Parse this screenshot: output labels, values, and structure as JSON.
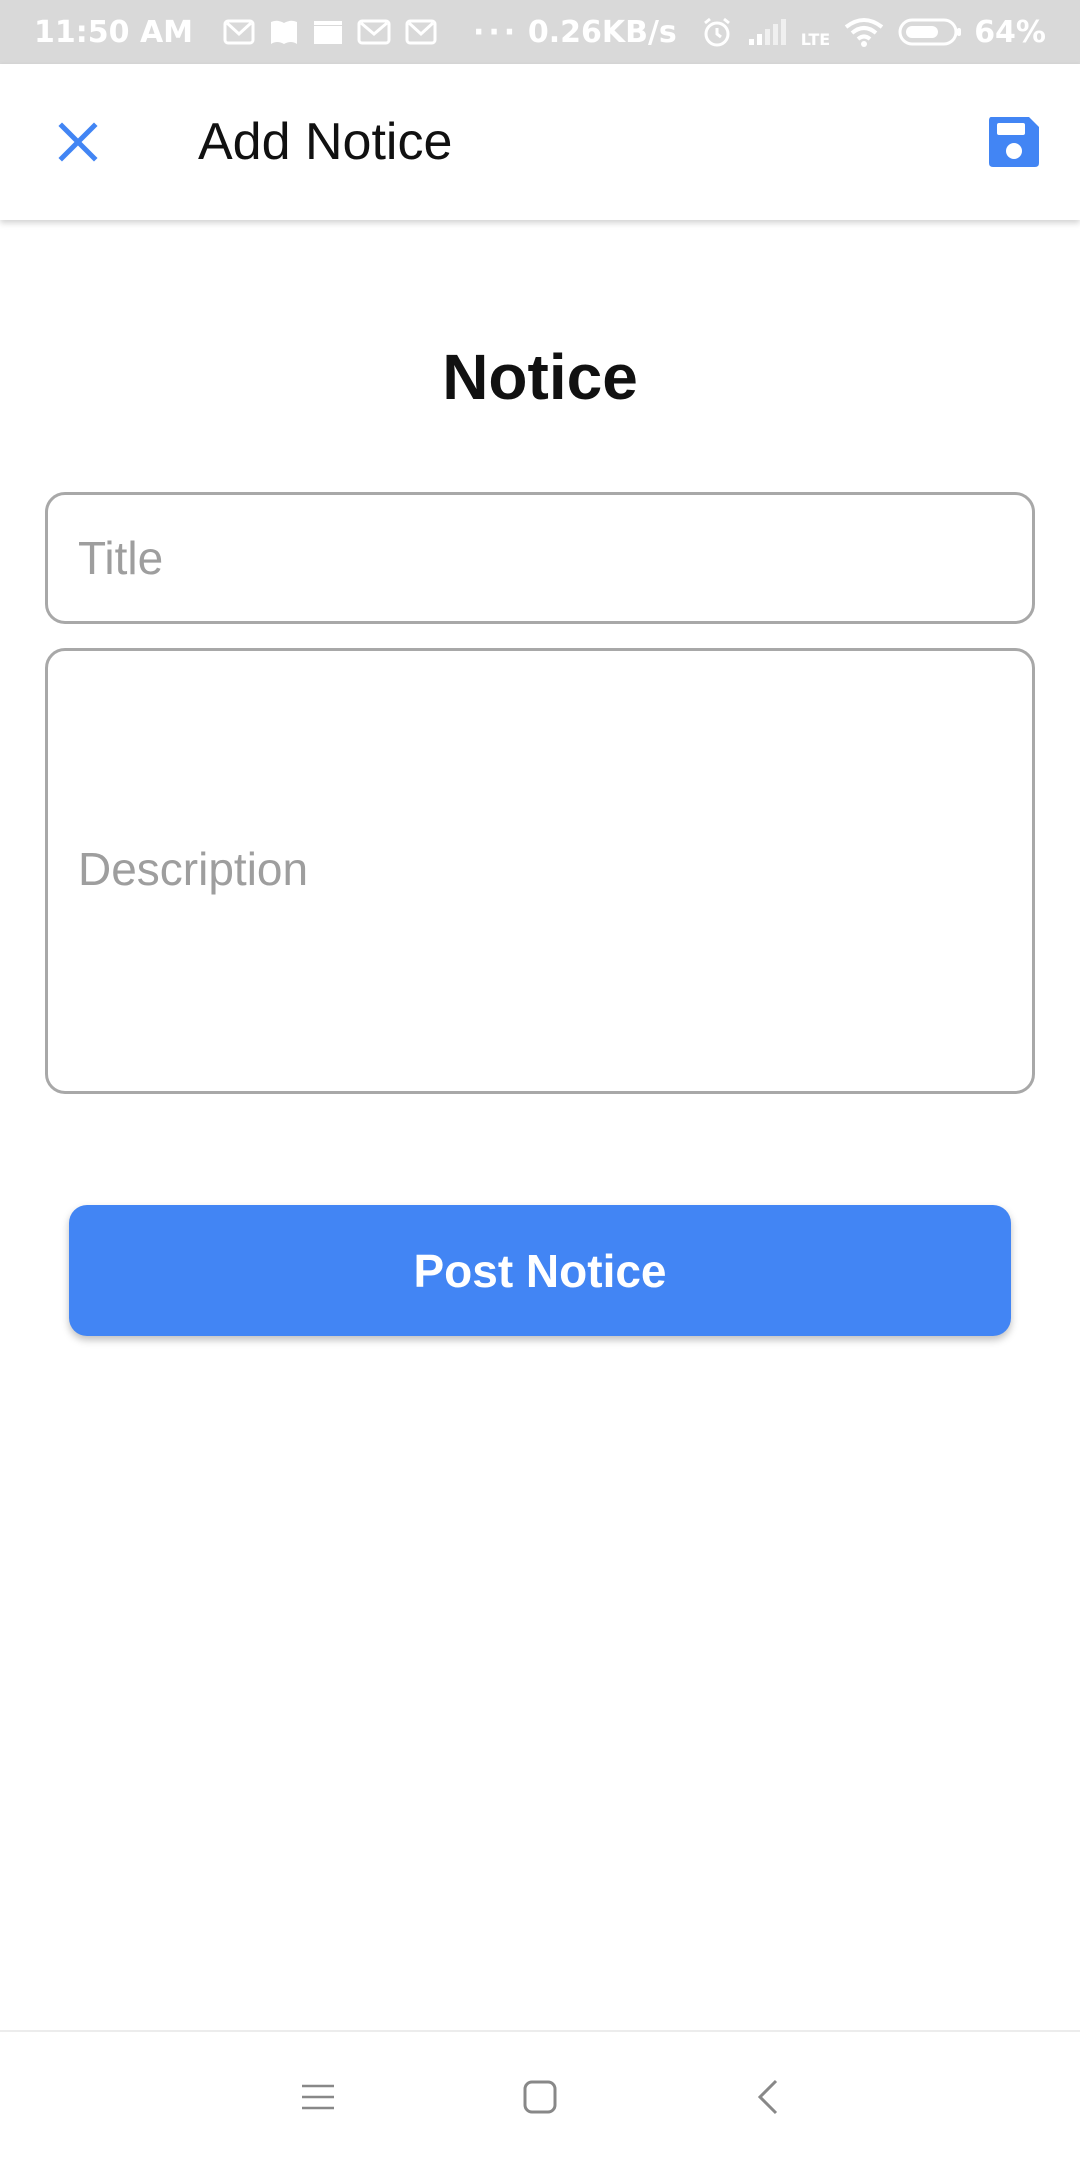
{
  "status_bar": {
    "time": "11:50 AM",
    "notification_icons": [
      "gmail-icon",
      "book-icon",
      "clapper-icon",
      "gmail-icon",
      "gmail-icon"
    ],
    "more": "···",
    "network_speed": "0.26KB/s",
    "network_type": "LTE",
    "battery": "64%"
  },
  "app_bar": {
    "title": "Add Notice",
    "close_icon": "close-icon",
    "save_icon": "save-icon",
    "accent_color": "#4285f4"
  },
  "form": {
    "heading": "Notice",
    "title_placeholder": "Title",
    "title_value": "",
    "description_placeholder": "Description",
    "description_value": "",
    "submit_label": "Post Notice",
    "button_color": "#4285f4"
  },
  "nav_bar": {
    "items": [
      "menu-icon",
      "home-icon",
      "back-icon"
    ]
  }
}
